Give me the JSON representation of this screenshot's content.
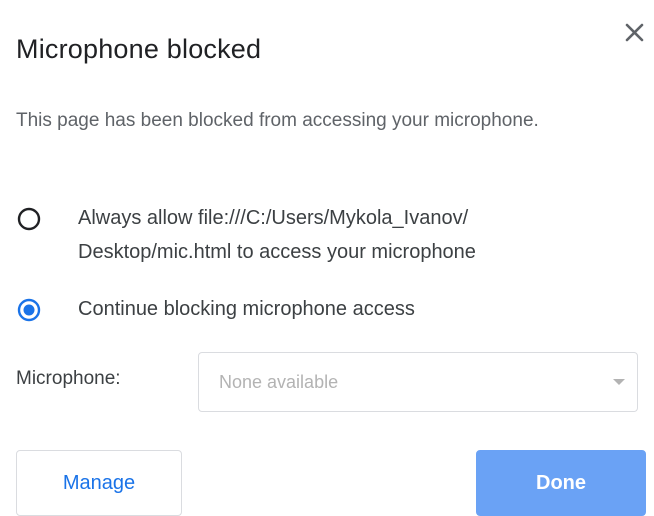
{
  "dialog": {
    "title": "Microphone blocked",
    "description": "This page has been blocked from accessing your microphone.",
    "options": [
      {
        "label_line1": "Always allow file:///C:/Users/Mykola_Ivanov/",
        "label_line2": "Desktop/mic.html to access your microphone",
        "selected": false
      },
      {
        "label_line1": "Continue blocking microphone access",
        "selected": true
      }
    ],
    "microphone": {
      "label": "Microphone:",
      "selected_value": "None available"
    },
    "buttons": {
      "manage": "Manage",
      "done": "Done"
    },
    "colors": {
      "accent": "#1a73e8",
      "done_bg": "#6aa2f5",
      "radio_unselected": "#202124"
    },
    "icons": {
      "close": "close-icon",
      "dropdown": "chevron-down-icon"
    }
  }
}
